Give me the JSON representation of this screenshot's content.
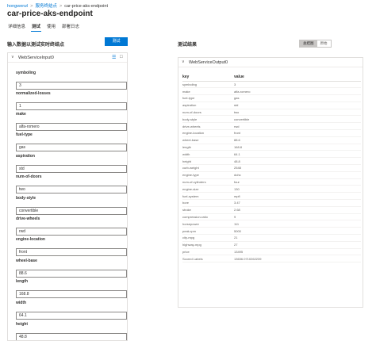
{
  "breadcrumb": {
    "workspace": "hongwenzl",
    "section": "服务终结点",
    "current": "car-price-aks-endpoint"
  },
  "page_title": "car-price-aks-endpoint",
  "tabs": [
    {
      "label": "详细信息",
      "active": false
    },
    {
      "label": "测试",
      "active": true
    },
    {
      "label": "使用",
      "active": false
    },
    {
      "label": "部署日志",
      "active": false
    }
  ],
  "left": {
    "heading": "输入数据以测试实时终结点",
    "test_button": "测试",
    "panel_title": "WebServiceInput0",
    "fields": [
      {
        "label": "symboling",
        "value": "3"
      },
      {
        "label": "normalized-losses",
        "value": "1"
      },
      {
        "label": "make",
        "value": "alfa-romero"
      },
      {
        "label": "fuel-type",
        "value": "gas"
      },
      {
        "label": "aspiration",
        "value": "std"
      },
      {
        "label": "num-of-doors",
        "value": "two"
      },
      {
        "label": "body-style",
        "value": "convertible"
      },
      {
        "label": "drive-wheels",
        "value": "rwd"
      },
      {
        "label": "engine-location",
        "value": "front"
      },
      {
        "label": "wheel-base",
        "value": "88.6"
      },
      {
        "label": "length",
        "value": "168.8"
      },
      {
        "label": "width",
        "value": "64.1"
      },
      {
        "label": "height",
        "value": "48.8"
      }
    ]
  },
  "right": {
    "heading": "测试结果",
    "toggle": {
      "on": "总结图",
      "off": "原始"
    },
    "panel_title": "WebServiceOutput0",
    "columns": {
      "key": "key",
      "value": "value"
    },
    "rows": [
      {
        "key": "symboling",
        "value": "3"
      },
      {
        "key": "make",
        "value": "alfa-romero"
      },
      {
        "key": "fuel-type",
        "value": "gas"
      },
      {
        "key": "aspiration",
        "value": "std"
      },
      {
        "key": "num-of-doors",
        "value": "two"
      },
      {
        "key": "body-style",
        "value": "convertible"
      },
      {
        "key": "drive-wheels",
        "value": "rwd"
      },
      {
        "key": "engine-location",
        "value": "front"
      },
      {
        "key": "wheel-base",
        "value": "88.6"
      },
      {
        "key": "length",
        "value": "168.8"
      },
      {
        "key": "width",
        "value": "64.1"
      },
      {
        "key": "height",
        "value": "48.8"
      },
      {
        "key": "curb-weight",
        "value": "2548"
      },
      {
        "key": "engine-type",
        "value": "dohc"
      },
      {
        "key": "num-of-cylinders",
        "value": "four"
      },
      {
        "key": "engine-size",
        "value": "130"
      },
      {
        "key": "fuel-system",
        "value": "mpfi"
      },
      {
        "key": "bore",
        "value": "3.47"
      },
      {
        "key": "stroke",
        "value": "2.68"
      },
      {
        "key": "compression-ratio",
        "value": "9"
      },
      {
        "key": "horsepower",
        "value": "111"
      },
      {
        "key": "peak-rpm",
        "value": "5000"
      },
      {
        "key": "city-mpg",
        "value": "21"
      },
      {
        "key": "highway-mpg",
        "value": "27"
      },
      {
        "key": "price",
        "value": "13495"
      },
      {
        "key": "Scored Labels",
        "value": "13636.0710262239"
      }
    ]
  }
}
